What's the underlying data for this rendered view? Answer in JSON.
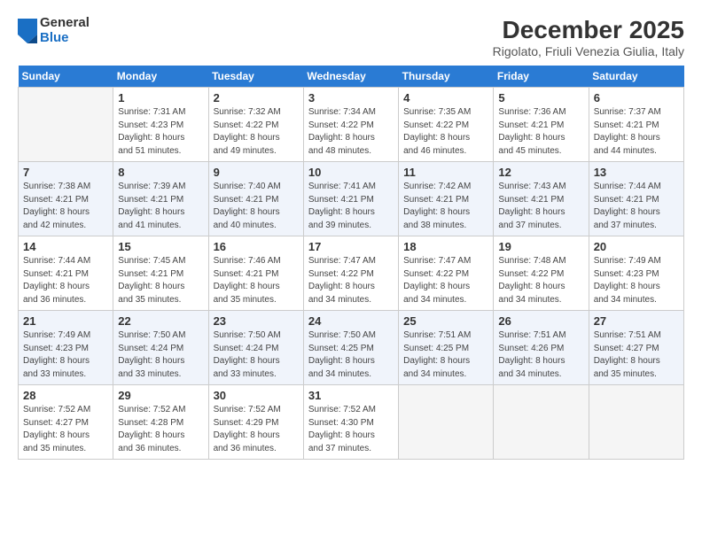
{
  "logo": {
    "general": "General",
    "blue": "Blue"
  },
  "header": {
    "title": "December 2025",
    "subtitle": "Rigolato, Friuli Venezia Giulia, Italy"
  },
  "weekdays": [
    "Sunday",
    "Monday",
    "Tuesday",
    "Wednesday",
    "Thursday",
    "Friday",
    "Saturday"
  ],
  "weeks": [
    [
      {
        "day": "",
        "sunrise": "",
        "sunset": "",
        "daylight": ""
      },
      {
        "day": "1",
        "sunrise": "Sunrise: 7:31 AM",
        "sunset": "Sunset: 4:23 PM",
        "daylight": "Daylight: 8 hours and 51 minutes."
      },
      {
        "day": "2",
        "sunrise": "Sunrise: 7:32 AM",
        "sunset": "Sunset: 4:22 PM",
        "daylight": "Daylight: 8 hours and 49 minutes."
      },
      {
        "day": "3",
        "sunrise": "Sunrise: 7:34 AM",
        "sunset": "Sunset: 4:22 PM",
        "daylight": "Daylight: 8 hours and 48 minutes."
      },
      {
        "day": "4",
        "sunrise": "Sunrise: 7:35 AM",
        "sunset": "Sunset: 4:22 PM",
        "daylight": "Daylight: 8 hours and 46 minutes."
      },
      {
        "day": "5",
        "sunrise": "Sunrise: 7:36 AM",
        "sunset": "Sunset: 4:21 PM",
        "daylight": "Daylight: 8 hours and 45 minutes."
      },
      {
        "day": "6",
        "sunrise": "Sunrise: 7:37 AM",
        "sunset": "Sunset: 4:21 PM",
        "daylight": "Daylight: 8 hours and 44 minutes."
      }
    ],
    [
      {
        "day": "7",
        "sunrise": "Sunrise: 7:38 AM",
        "sunset": "Sunset: 4:21 PM",
        "daylight": "Daylight: 8 hours and 42 minutes."
      },
      {
        "day": "8",
        "sunrise": "Sunrise: 7:39 AM",
        "sunset": "Sunset: 4:21 PM",
        "daylight": "Daylight: 8 hours and 41 minutes."
      },
      {
        "day": "9",
        "sunrise": "Sunrise: 7:40 AM",
        "sunset": "Sunset: 4:21 PM",
        "daylight": "Daylight: 8 hours and 40 minutes."
      },
      {
        "day": "10",
        "sunrise": "Sunrise: 7:41 AM",
        "sunset": "Sunset: 4:21 PM",
        "daylight": "Daylight: 8 hours and 39 minutes."
      },
      {
        "day": "11",
        "sunrise": "Sunrise: 7:42 AM",
        "sunset": "Sunset: 4:21 PM",
        "daylight": "Daylight: 8 hours and 38 minutes."
      },
      {
        "day": "12",
        "sunrise": "Sunrise: 7:43 AM",
        "sunset": "Sunset: 4:21 PM",
        "daylight": "Daylight: 8 hours and 37 minutes."
      },
      {
        "day": "13",
        "sunrise": "Sunrise: 7:44 AM",
        "sunset": "Sunset: 4:21 PM",
        "daylight": "Daylight: 8 hours and 37 minutes."
      }
    ],
    [
      {
        "day": "14",
        "sunrise": "Sunrise: 7:44 AM",
        "sunset": "Sunset: 4:21 PM",
        "daylight": "Daylight: 8 hours and 36 minutes."
      },
      {
        "day": "15",
        "sunrise": "Sunrise: 7:45 AM",
        "sunset": "Sunset: 4:21 PM",
        "daylight": "Daylight: 8 hours and 35 minutes."
      },
      {
        "day": "16",
        "sunrise": "Sunrise: 7:46 AM",
        "sunset": "Sunset: 4:21 PM",
        "daylight": "Daylight: 8 hours and 35 minutes."
      },
      {
        "day": "17",
        "sunrise": "Sunrise: 7:47 AM",
        "sunset": "Sunset: 4:22 PM",
        "daylight": "Daylight: 8 hours and 34 minutes."
      },
      {
        "day": "18",
        "sunrise": "Sunrise: 7:47 AM",
        "sunset": "Sunset: 4:22 PM",
        "daylight": "Daylight: 8 hours and 34 minutes."
      },
      {
        "day": "19",
        "sunrise": "Sunrise: 7:48 AM",
        "sunset": "Sunset: 4:22 PM",
        "daylight": "Daylight: 8 hours and 34 minutes."
      },
      {
        "day": "20",
        "sunrise": "Sunrise: 7:49 AM",
        "sunset": "Sunset: 4:23 PM",
        "daylight": "Daylight: 8 hours and 34 minutes."
      }
    ],
    [
      {
        "day": "21",
        "sunrise": "Sunrise: 7:49 AM",
        "sunset": "Sunset: 4:23 PM",
        "daylight": "Daylight: 8 hours and 33 minutes."
      },
      {
        "day": "22",
        "sunrise": "Sunrise: 7:50 AM",
        "sunset": "Sunset: 4:24 PM",
        "daylight": "Daylight: 8 hours and 33 minutes."
      },
      {
        "day": "23",
        "sunrise": "Sunrise: 7:50 AM",
        "sunset": "Sunset: 4:24 PM",
        "daylight": "Daylight: 8 hours and 33 minutes."
      },
      {
        "day": "24",
        "sunrise": "Sunrise: 7:50 AM",
        "sunset": "Sunset: 4:25 PM",
        "daylight": "Daylight: 8 hours and 34 minutes."
      },
      {
        "day": "25",
        "sunrise": "Sunrise: 7:51 AM",
        "sunset": "Sunset: 4:25 PM",
        "daylight": "Daylight: 8 hours and 34 minutes."
      },
      {
        "day": "26",
        "sunrise": "Sunrise: 7:51 AM",
        "sunset": "Sunset: 4:26 PM",
        "daylight": "Daylight: 8 hours and 34 minutes."
      },
      {
        "day": "27",
        "sunrise": "Sunrise: 7:51 AM",
        "sunset": "Sunset: 4:27 PM",
        "daylight": "Daylight: 8 hours and 35 minutes."
      }
    ],
    [
      {
        "day": "28",
        "sunrise": "Sunrise: 7:52 AM",
        "sunset": "Sunset: 4:27 PM",
        "daylight": "Daylight: 8 hours and 35 minutes."
      },
      {
        "day": "29",
        "sunrise": "Sunrise: 7:52 AM",
        "sunset": "Sunset: 4:28 PM",
        "daylight": "Daylight: 8 hours and 36 minutes."
      },
      {
        "day": "30",
        "sunrise": "Sunrise: 7:52 AM",
        "sunset": "Sunset: 4:29 PM",
        "daylight": "Daylight: 8 hours and 36 minutes."
      },
      {
        "day": "31",
        "sunrise": "Sunrise: 7:52 AM",
        "sunset": "Sunset: 4:30 PM",
        "daylight": "Daylight: 8 hours and 37 minutes."
      },
      {
        "day": "",
        "sunrise": "",
        "sunset": "",
        "daylight": ""
      },
      {
        "day": "",
        "sunrise": "",
        "sunset": "",
        "daylight": ""
      },
      {
        "day": "",
        "sunrise": "",
        "sunset": "",
        "daylight": ""
      }
    ]
  ]
}
